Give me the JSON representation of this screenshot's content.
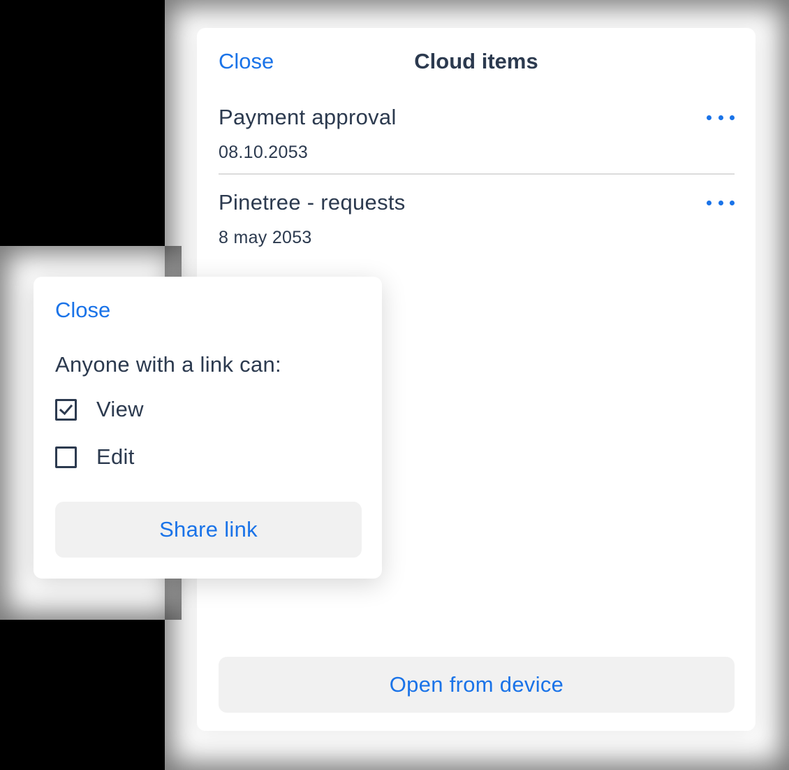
{
  "colors": {
    "accent": "#1a73e8",
    "text": "#2c3a4f",
    "button_bg": "#f1f1f1",
    "divider": "#dcdcdc"
  },
  "cloud_panel": {
    "close_label": "Close",
    "title": "Cloud items",
    "items": [
      {
        "name": "Payment approval",
        "date": "08.10.2053",
        "menu_icon": "more-horizontal-icon"
      },
      {
        "name": "Pinetree - requests",
        "date": "8 may 2053",
        "menu_icon": "more-horizontal-icon"
      }
    ],
    "open_button_label": "Open from device"
  },
  "share_panel": {
    "close_label": "Close",
    "heading": "Anyone with a link can:",
    "options": [
      {
        "label": "View",
        "checked": true
      },
      {
        "label": "Edit",
        "checked": false
      }
    ],
    "share_button_label": "Share link"
  }
}
